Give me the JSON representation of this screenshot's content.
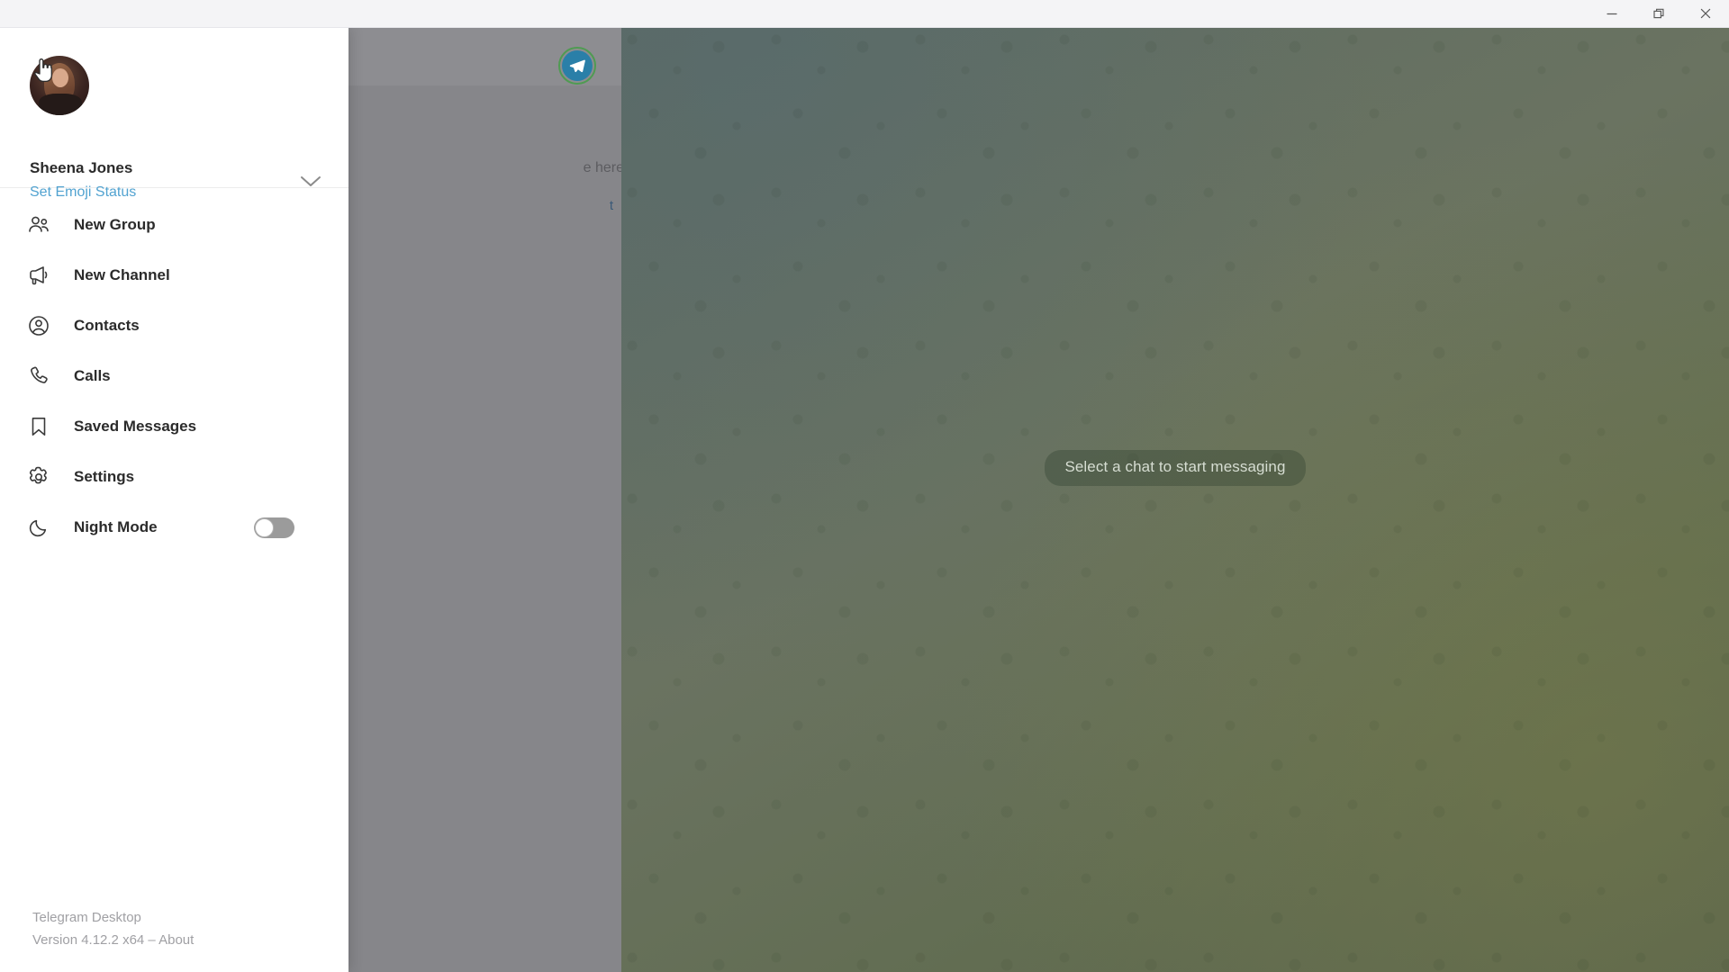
{
  "window": {
    "controls": [
      {
        "name": "minimize",
        "label": "Minimize"
      },
      {
        "name": "restore",
        "label": "Restore"
      },
      {
        "name": "close",
        "label": "Close"
      }
    ]
  },
  "menu": {
    "profile": {
      "name": "Sheena Jones",
      "status_label": "Set Emoji Status",
      "expand_icon": "chevron-down-icon",
      "avatar_alt": "Sheena Jones avatar"
    },
    "items": [
      {
        "label": "New Group",
        "icon": "people-icon"
      },
      {
        "label": "New Channel",
        "icon": "megaphone-icon"
      },
      {
        "label": "Contacts",
        "icon": "user-circle-icon"
      },
      {
        "label": "Calls",
        "icon": "phone-icon"
      },
      {
        "label": "Saved Messages",
        "icon": "bookmark-icon"
      },
      {
        "label": "Settings",
        "icon": "gear-icon"
      },
      {
        "label": "Night Mode",
        "icon": "moon-icon",
        "toggle": "off"
      }
    ],
    "footer": {
      "app_name": "Telegram Desktop",
      "version": "Version 4.12.2 x64 – About"
    }
  },
  "chat_list": {
    "logo_icon": "telegram-plane-icon",
    "hint_fragment": "e here",
    "link_fragment": "t"
  },
  "chat": {
    "placeholder": "Select a chat to start messaging"
  },
  "colors": {
    "accent_blue": "#52a3d1",
    "logo_blue": "#2a7fa8",
    "logo_ring_green": "#4f9b52",
    "chat_background": "#66705c",
    "panel_background": "#ffffff",
    "dim_overlay": "#86868a",
    "text_primary": "#2b2b2b",
    "text_muted": "#a0a0a4"
  }
}
